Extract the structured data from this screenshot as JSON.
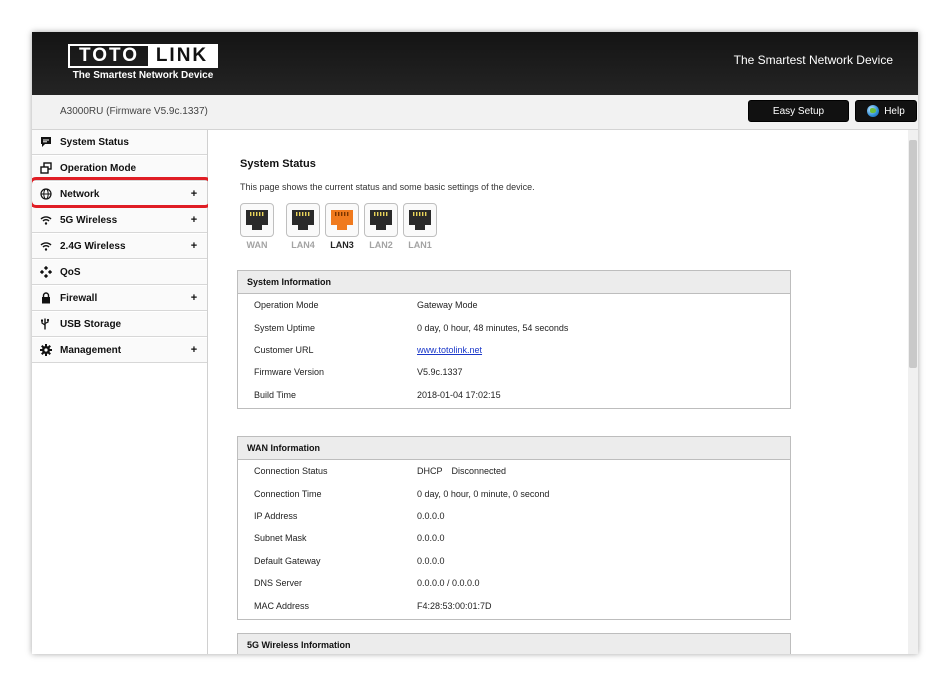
{
  "header": {
    "logo_left": "TOTO",
    "logo_right": "LINK",
    "logo_tagline": "The Smartest Network Device",
    "slogan": "The Smartest Network Device"
  },
  "subbar": {
    "model_info": "A3000RU (Firmware V5.9c.1337)",
    "easy_setup_label": "Easy Setup",
    "help_label": "Help"
  },
  "sidebar": {
    "items": [
      {
        "label": "System Status",
        "icon": "chat-bubble-icon",
        "expandable": false
      },
      {
        "label": "Operation Mode",
        "icon": "windows-icon",
        "expandable": false
      },
      {
        "label": "Network",
        "icon": "globe-icon",
        "expandable": true
      },
      {
        "label": "5G Wireless",
        "icon": "wifi-icon",
        "expandable": true
      },
      {
        "label": "2.4G Wireless",
        "icon": "wifi-icon",
        "expandable": true
      },
      {
        "label": "QoS",
        "icon": "diamond-arrows-icon",
        "expandable": false
      },
      {
        "label": "Firewall",
        "icon": "lock-icon",
        "expandable": true
      },
      {
        "label": "USB Storage",
        "icon": "usb-icon",
        "expandable": false
      },
      {
        "label": "Management",
        "icon": "gear-icon",
        "expandable": true
      }
    ],
    "plus": "+"
  },
  "main": {
    "title": "System Status",
    "description": "This page shows the current status and some basic settings of the device.",
    "ports": [
      {
        "label": "WAN",
        "active": false
      },
      {
        "label": "LAN4",
        "active": false
      },
      {
        "label": "LAN3",
        "active": true
      },
      {
        "label": "LAN2",
        "active": false
      },
      {
        "label": "LAN1",
        "active": false
      }
    ],
    "system_info": {
      "title": "System Information",
      "rows": [
        {
          "key": "Operation Mode",
          "value": "Gateway Mode"
        },
        {
          "key": "System Uptime",
          "value": "0 day, 0 hour, 48 minutes, 54 seconds"
        },
        {
          "key": "Customer URL",
          "value": "www.totolink.net"
        },
        {
          "key": "Firmware Version",
          "value": "V5.9c.1337"
        },
        {
          "key": "Build Time",
          "value": "2018-01-04 17:02:15"
        }
      ]
    },
    "wan_info": {
      "title": "WAN Information",
      "rows": [
        {
          "key": "Connection Status",
          "value": "DHCP",
          "value2": "Disconnected"
        },
        {
          "key": "Connection Time",
          "value": "0 day, 0 hour, 0 minute, 0 second"
        },
        {
          "key": "IP Address",
          "value": "0.0.0.0"
        },
        {
          "key": "Subnet Mask",
          "value": "0.0.0.0"
        },
        {
          "key": "Default Gateway",
          "value": "0.0.0.0"
        },
        {
          "key": "DNS Server",
          "value": "0.0.0.0 / 0.0.0.0"
        },
        {
          "key": "MAC Address",
          "value": "F4:28:53:00:01:7D"
        }
      ]
    },
    "wireless5g_info": {
      "title": "5G Wireless Information"
    }
  },
  "colors": {
    "highlight": "#e01e25",
    "active_port": "#f07a1e",
    "link": "#1a37c9"
  }
}
